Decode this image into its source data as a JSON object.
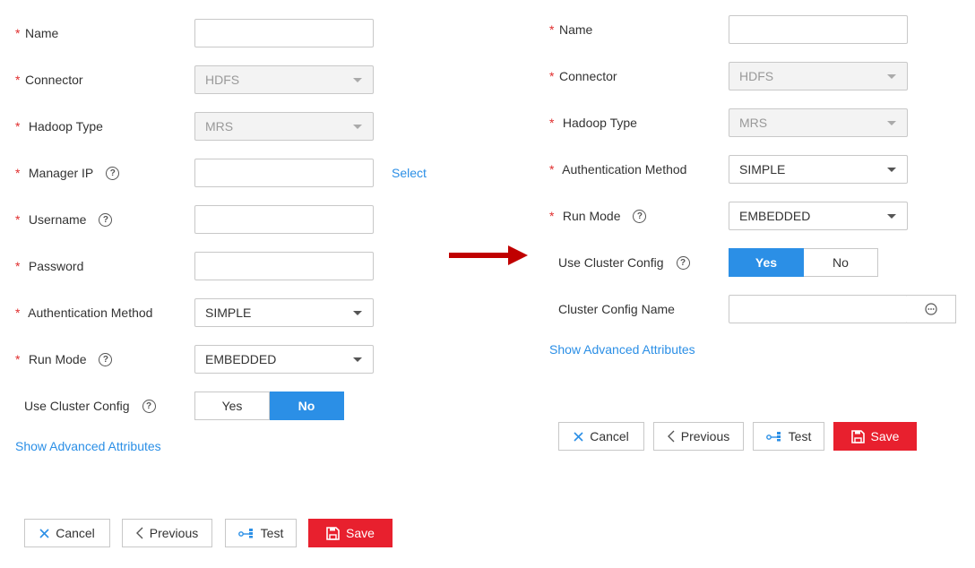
{
  "left": {
    "name_label": "Name",
    "connector_label": "Connector",
    "connector_value": "HDFS",
    "hadoop_type_label": "Hadoop Type",
    "hadoop_type_value": "MRS",
    "manager_ip_label": "Manager IP",
    "select_link": "Select",
    "username_label": "Username",
    "password_label": "Password",
    "auth_method_label": "Authentication Method",
    "auth_method_value": "SIMPLE",
    "run_mode_label": "Run Mode",
    "run_mode_value": "EMBEDDED",
    "use_cluster_config_label": "Use Cluster Config",
    "yes_label": "Yes",
    "no_label": "No",
    "use_cluster_config_selected": "No",
    "advanced_link": "Show Advanced Attributes",
    "buttons": {
      "cancel": "Cancel",
      "previous": "Previous",
      "test": "Test",
      "save": "Save"
    }
  },
  "right": {
    "name_label": "Name",
    "connector_label": "Connector",
    "connector_value": "HDFS",
    "hadoop_type_label": "Hadoop Type",
    "hadoop_type_value": "MRS",
    "auth_method_label": "Authentication Method",
    "auth_method_value": "SIMPLE",
    "run_mode_label": "Run Mode",
    "run_mode_value": "EMBEDDED",
    "use_cluster_config_label": "Use Cluster Config",
    "yes_label": "Yes",
    "no_label": "No",
    "use_cluster_config_selected": "Yes",
    "cluster_config_name_label": "Cluster Config Name",
    "advanced_link": "Show Advanced Attributes",
    "buttons": {
      "cancel": "Cancel",
      "previous": "Previous",
      "test": "Test",
      "save": "Save"
    }
  },
  "required_mark": "*",
  "help_glyph": "?",
  "colors": {
    "accent": "#2b8fe6",
    "danger": "#e8202e",
    "arrow": "#c00000",
    "required": "#e02d2d"
  }
}
